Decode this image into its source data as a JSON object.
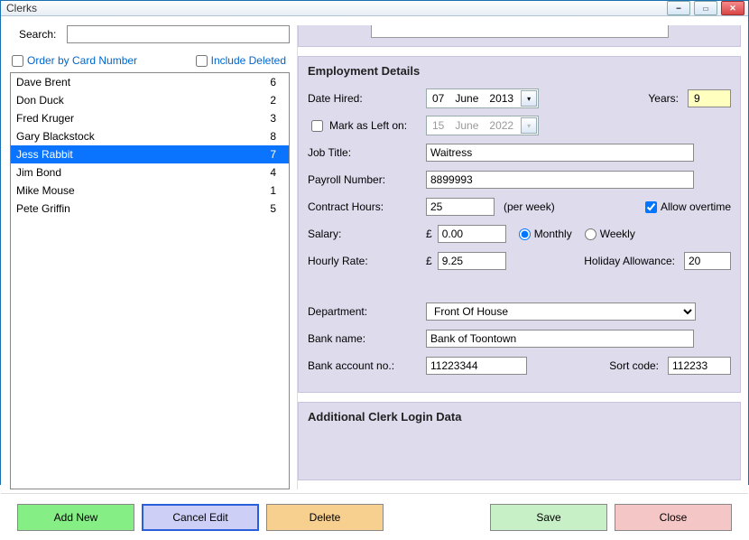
{
  "window": {
    "title": "Clerks"
  },
  "search": {
    "label": "Search:",
    "value": ""
  },
  "filters": {
    "order_by_card_label": "Order by Card Number",
    "order_by_card_checked": false,
    "include_deleted_label": "Include Deleted",
    "include_deleted_checked": false
  },
  "clerks": [
    {
      "name": "Dave Brent",
      "num": "6",
      "selected": false
    },
    {
      "name": "Don Duck",
      "num": "2",
      "selected": false
    },
    {
      "name": "Fred Kruger",
      "num": "3",
      "selected": false
    },
    {
      "name": "Gary Blackstock",
      "num": "8",
      "selected": false
    },
    {
      "name": "Jess Rabbit",
      "num": "7",
      "selected": true
    },
    {
      "name": "Jim Bond",
      "num": "4",
      "selected": false
    },
    {
      "name": "Mike Mouse",
      "num": "1",
      "selected": false
    },
    {
      "name": "Pete Griffin",
      "num": "5",
      "selected": false
    }
  ],
  "employment": {
    "heading": "Employment Details",
    "date_hired_label": "Date Hired:",
    "date_hired": {
      "day": "07",
      "month": "June",
      "year": "2013"
    },
    "years_label": "Years:",
    "years_value": "9",
    "mark_left_label": "Mark as Left on:",
    "mark_left_checked": false,
    "date_left": {
      "day": "15",
      "month": "June",
      "year": "2022"
    },
    "job_title_label": "Job Title:",
    "job_title_value": "Waitress",
    "payroll_label": "Payroll Number:",
    "payroll_value": "8899993",
    "contract_hours_label": "Contract Hours:",
    "contract_hours_value": "25",
    "per_week_label": "(per week)",
    "allow_overtime_label": "Allow overtime",
    "allow_overtime_checked": true,
    "salary_label": "Salary:",
    "currency_symbol": "£",
    "salary_value": "0.00",
    "monthly_label": "Monthly",
    "weekly_label": "Weekly",
    "salary_period": "monthly",
    "hourly_rate_label": "Hourly Rate:",
    "hourly_rate_value": "9.25",
    "holiday_allowance_label": "Holiday Allowance:",
    "holiday_allowance_value": "20",
    "department_label": "Department:",
    "department_value": "Front Of House",
    "bank_name_label": "Bank name:",
    "bank_name_value": "Bank of Toontown",
    "bank_account_label": "Bank account no.:",
    "bank_account_value": "11223344",
    "sort_code_label": "Sort code:",
    "sort_code_value": "112233"
  },
  "additional": {
    "heading": "Additional Clerk Login Data"
  },
  "buttons": {
    "add_new": "Add New",
    "cancel_edit": "Cancel Edit",
    "delete": "Delete",
    "save": "Save",
    "close": "Close"
  }
}
